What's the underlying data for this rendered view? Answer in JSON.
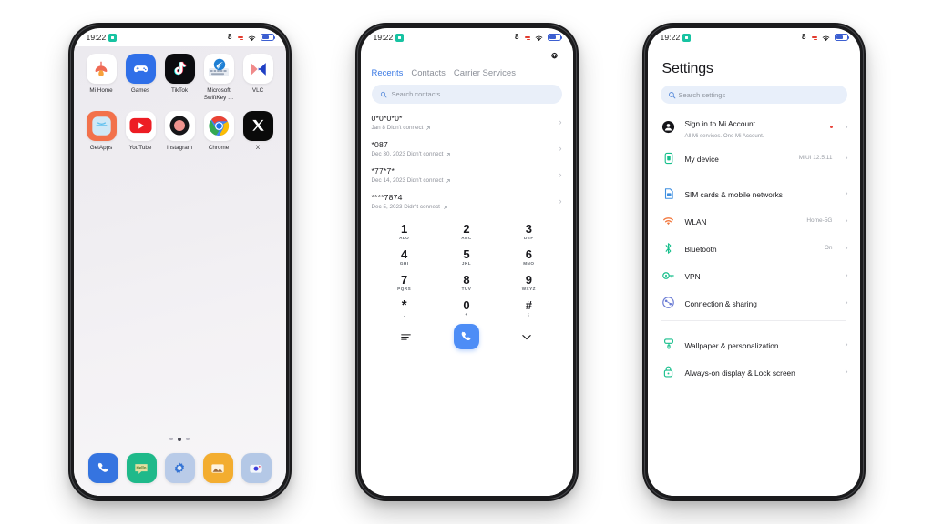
{
  "status_bar": {
    "time": "19:22",
    "icons": [
      "notification-badge-icon",
      "bluetooth-icon",
      "signal-bars-icon",
      "wifi-icon",
      "battery-icon"
    ]
  },
  "phone1": {
    "name": "home-screen",
    "apps_row1": [
      {
        "label": "Mi Home",
        "icon": "mi-home-icon"
      },
      {
        "label": "Games",
        "icon": "games-icon"
      },
      {
        "label": "TikTok",
        "icon": "tiktok-icon"
      },
      {
        "label": "Microsoft SwiftKey …",
        "icon": "microsoft-swiftkey-icon"
      },
      {
        "label": "VLC",
        "icon": "vlc-icon"
      }
    ],
    "apps_row2": [
      {
        "label": "GetApps",
        "icon": "getapps-icon"
      },
      {
        "label": "YouTube",
        "icon": "youtube-icon"
      },
      {
        "label": "Instagram",
        "icon": "instagram-icon"
      },
      {
        "label": "Chrome",
        "icon": "chrome-icon"
      },
      {
        "label": "X",
        "icon": "x-icon"
      }
    ],
    "dock": [
      {
        "label": "Phone",
        "icon": "phone-icon"
      },
      {
        "label": "Messages",
        "icon": "messages-icon",
        "badge_text": "Hello"
      },
      {
        "label": "Settings",
        "icon": "settings-gear-icon"
      },
      {
        "label": "Gallery",
        "icon": "gallery-icon"
      },
      {
        "label": "Camera",
        "icon": "camera-icon"
      }
    ],
    "page_indicator": {
      "count": 3,
      "active": 2
    }
  },
  "phone2": {
    "name": "dialer-screen",
    "tabs": [
      {
        "label": "Recents",
        "active": true
      },
      {
        "label": "Contacts",
        "active": false
      },
      {
        "label": "Carrier Services",
        "active": false
      }
    ],
    "search": {
      "placeholder": "Search contacts",
      "value": ""
    },
    "calls": [
      {
        "number": "0*0*0*0*",
        "detail": "Jan 8 Didn't connect"
      },
      {
        "number": "*087",
        "detail": "Dec 30, 2023 Didn't connect"
      },
      {
        "number": "*77*7*",
        "detail": "Dec 14, 2023 Didn't connect"
      },
      {
        "number": "****7874",
        "detail": "Dec 5, 2023 Didn't connect"
      }
    ],
    "keypad": [
      {
        "digit": "1",
        "letters": "ALO"
      },
      {
        "digit": "2",
        "letters": "ABC"
      },
      {
        "digit": "3",
        "letters": "DEF"
      },
      {
        "digit": "4",
        "letters": "GHI"
      },
      {
        "digit": "5",
        "letters": "JKL"
      },
      {
        "digit": "6",
        "letters": "MNO"
      },
      {
        "digit": "7",
        "letters": "PQRS"
      },
      {
        "digit": "8",
        "letters": "TUV"
      },
      {
        "digit": "9",
        "letters": "WXYZ"
      },
      {
        "digit": "*",
        "letters": ","
      },
      {
        "digit": "0",
        "letters": "+"
      },
      {
        "digit": "#",
        "letters": ";"
      }
    ],
    "bottom": {
      "menu_icon": "menu-icon",
      "call_icon": "call-icon",
      "collapse_icon": "chevron-down-icon"
    }
  },
  "phone3": {
    "name": "settings-screen",
    "title": "Settings",
    "search": {
      "placeholder": "Search settings",
      "value": ""
    },
    "items": [
      {
        "label": "Sign in to Mi Account",
        "desc": "All Mi services. One Mi Account.",
        "value": "",
        "icon": "account-icon",
        "dot": true
      },
      {
        "label": "My device",
        "desc": "",
        "value": "MIUI 12.5.11",
        "icon": "device-icon",
        "dot": false
      },
      {
        "label": "SIM cards & mobile networks",
        "desc": "",
        "value": "",
        "icon": "sim-card-icon",
        "dot": false
      },
      {
        "label": "WLAN",
        "desc": "",
        "value": "Home-5G",
        "icon": "wifi-icon",
        "dot": false
      },
      {
        "label": "Bluetooth",
        "desc": "",
        "value": "On",
        "icon": "bluetooth-icon",
        "dot": false
      },
      {
        "label": "VPN",
        "desc": "",
        "value": "",
        "icon": "vpn-key-icon",
        "dot": false
      },
      {
        "label": "Connection & sharing",
        "desc": "",
        "value": "",
        "icon": "connection-sharing-icon",
        "dot": false
      },
      {
        "label": "Wallpaper & personalization",
        "desc": "",
        "value": "",
        "icon": "wallpaper-brush-icon",
        "dot": false
      },
      {
        "label": "Always-on display & Lock screen",
        "desc": "",
        "value": "",
        "icon": "lock-icon",
        "dot": false
      }
    ]
  },
  "colors": {
    "accent_blue": "#3b7ae4",
    "call_green_teal": "#17c3a2",
    "signal_red": "#e23b2e",
    "settings_icon_green": "#1fbf8f",
    "search_field_bg": "#e8effa"
  }
}
